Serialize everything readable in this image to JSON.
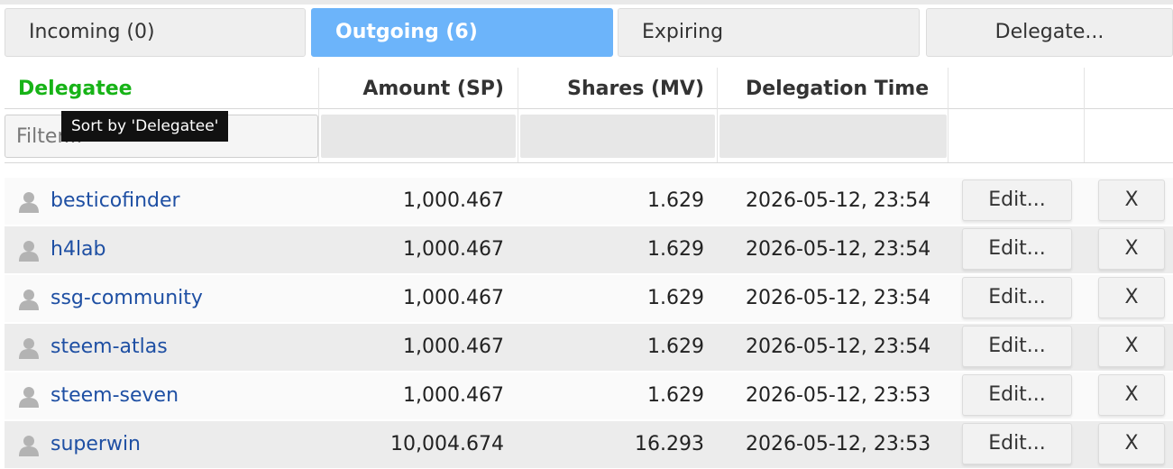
{
  "tabs": [
    {
      "label": "Incoming (0)",
      "active": false
    },
    {
      "label": "Outgoing (6)",
      "active": true
    },
    {
      "label": "Expiring",
      "active": false
    },
    {
      "label": "Delegate...",
      "active": false
    }
  ],
  "table": {
    "columns": [
      "Delegatee",
      "Amount (SP)",
      "Shares (MV)",
      "Delegation Time"
    ],
    "sorted_column": "Delegatee",
    "filter_placeholder": "Filter...",
    "tooltip": "Sort by 'Delegatee'",
    "edit_label": "Edit...",
    "remove_label": "X",
    "rows": [
      {
        "delegatee": "besticofinder",
        "amount": "1,000.467",
        "shares": "1.629",
        "time": "2026-05-12, 23:54"
      },
      {
        "delegatee": "h4lab",
        "amount": "1,000.467",
        "shares": "1.629",
        "time": "2026-05-12, 23:54"
      },
      {
        "delegatee": "ssg-community",
        "amount": "1,000.467",
        "shares": "1.629",
        "time": "2026-05-12, 23:54"
      },
      {
        "delegatee": "steem-atlas",
        "amount": "1,000.467",
        "shares": "1.629",
        "time": "2026-05-12, 23:54"
      },
      {
        "delegatee": "steem-seven",
        "amount": "1,000.467",
        "shares": "1.629",
        "time": "2026-05-12, 23:53"
      },
      {
        "delegatee": "superwin",
        "amount": "10,004.674",
        "shares": "16.293",
        "time": "2026-05-12, 23:53"
      }
    ]
  },
  "colors": {
    "active_tab": "#6cb4fa",
    "sorted_header": "#17b317",
    "link": "#1e4fa3",
    "tooltip_bg": "#111111"
  },
  "icons": {
    "avatar": "user-silhouette-icon"
  }
}
